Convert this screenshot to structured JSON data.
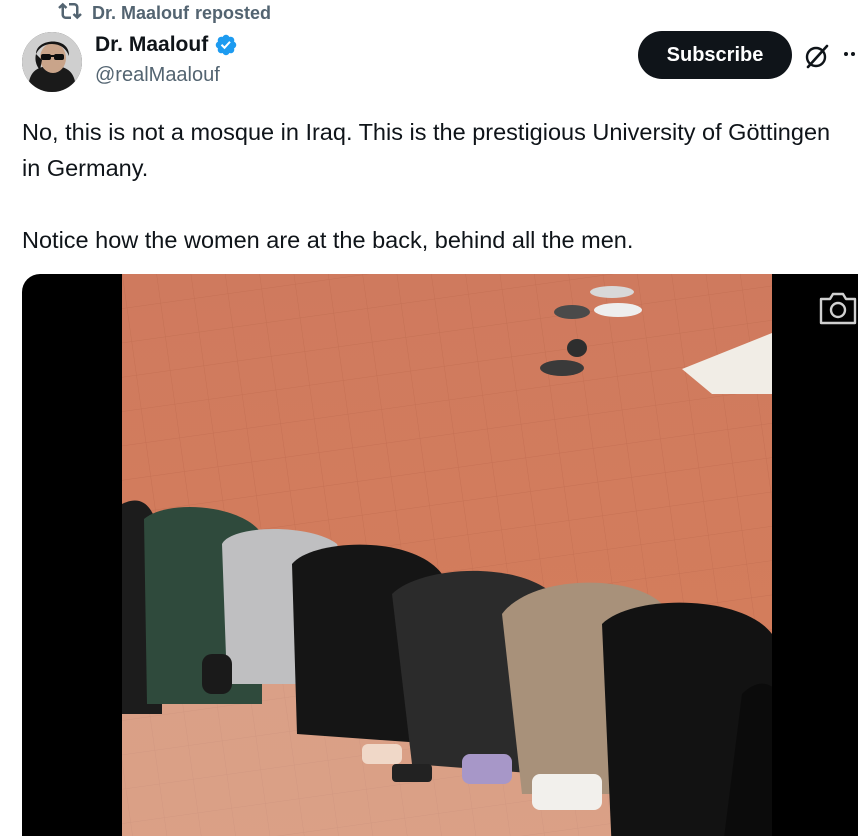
{
  "repost": {
    "icon": "repost-icon",
    "author": "Dr. Maalouf",
    "label": "reposted"
  },
  "author": {
    "name": "Dr. Maalouf",
    "handle": "@realMaalouf",
    "verified": true,
    "verified_color": "#1d9bf0"
  },
  "actions": {
    "subscribe_label": "Subscribe",
    "grok_icon": "grok-icon",
    "more_icon": "more-icon"
  },
  "tweet": {
    "paragraph_1": "No, this is not a mosque in Iraq. This is the prestigious University of Göttingen in Germany.",
    "paragraph_2": "Notice how the women are at the back, behind all the men."
  },
  "media": {
    "type": "video",
    "camera_icon": "camera-icon",
    "floor_color": "#d17755"
  }
}
